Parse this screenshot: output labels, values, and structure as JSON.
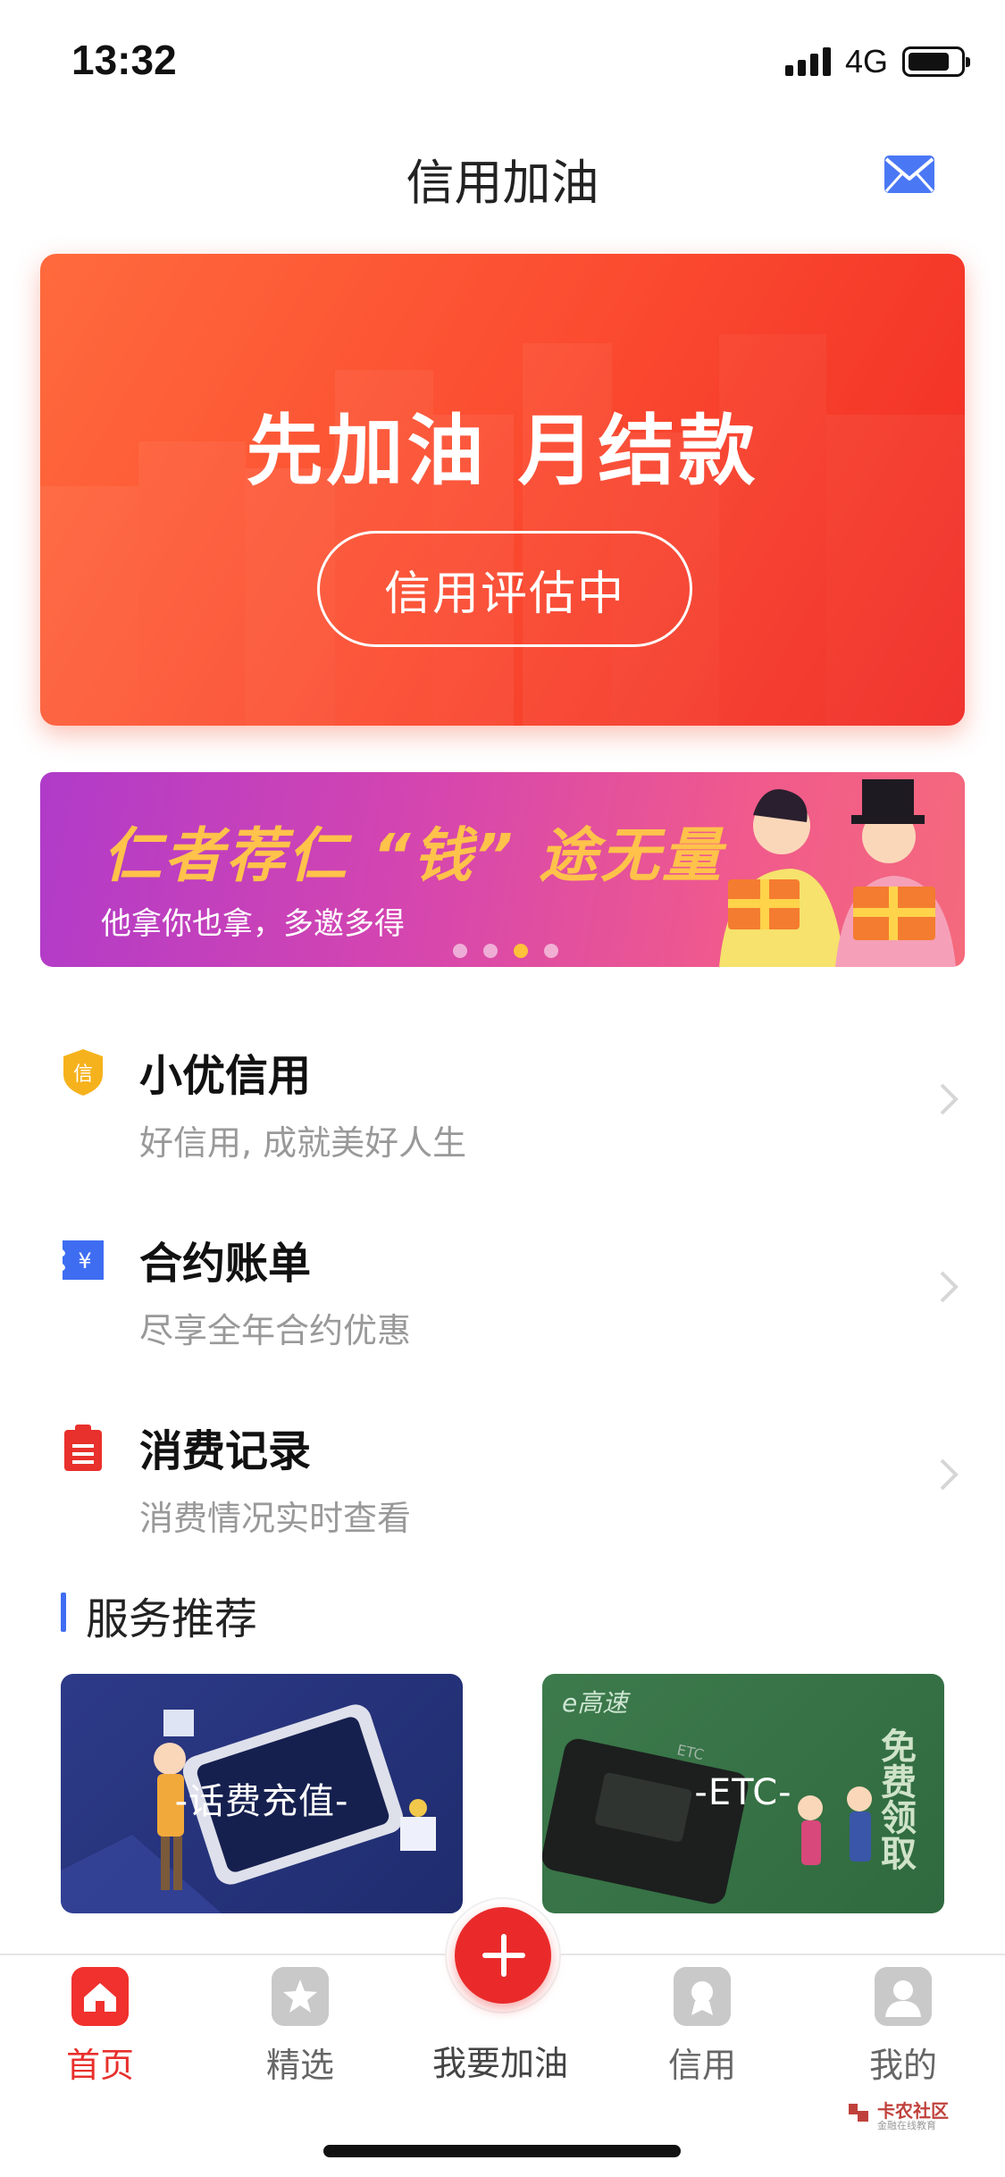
{
  "status_bar": {
    "time": "13:32",
    "network": "4G",
    "battery_level": 0.8
  },
  "nav": {
    "title": "信用加油",
    "mail_icon": "mail-icon"
  },
  "hero": {
    "title": "先加油 月结款",
    "button_label": "信用评估中"
  },
  "promo_banner": {
    "title": "仁者荐仁 “钱” 途无量",
    "subtitle": "他拿你也拿，多邀多得",
    "page_count": 4,
    "active_page": 3
  },
  "list": [
    {
      "icon": "shield-credit-icon",
      "title": "小优信用",
      "subtitle": "好信用, 成就美好人生",
      "color": "#f6b21c"
    },
    {
      "icon": "yuan-ticket-icon",
      "title": "合约账单",
      "subtitle": "尽享全年合约优惠",
      "color": "#3f6df2"
    },
    {
      "icon": "clipboard-icon",
      "title": "消费记录",
      "subtitle": "消费情况实时查看",
      "color": "#e8302c"
    }
  ],
  "services": {
    "title": "服务推荐",
    "cards": [
      {
        "label": "-话费充值-"
      },
      {
        "label": "-ETC-",
        "brand_text": "e高速",
        "side_text": "免费领取",
        "card_text": "ETC"
      }
    ]
  },
  "tabbar": {
    "tabs": [
      {
        "label": "首页",
        "icon": "home-icon",
        "active": true
      },
      {
        "label": "精选",
        "icon": "star-tag-icon",
        "active": false
      },
      {
        "label": "信用",
        "icon": "badge-icon",
        "active": false
      },
      {
        "label": "我的",
        "icon": "profile-icon",
        "active": false
      }
    ],
    "center_label": "我要加油"
  },
  "watermark": {
    "name": "卡农社区",
    "tagline": "金融在线教育"
  },
  "colors": {
    "accent_red": "#e8302c",
    "brand_blue": "#3f6df2",
    "gold": "#ffc24a"
  }
}
